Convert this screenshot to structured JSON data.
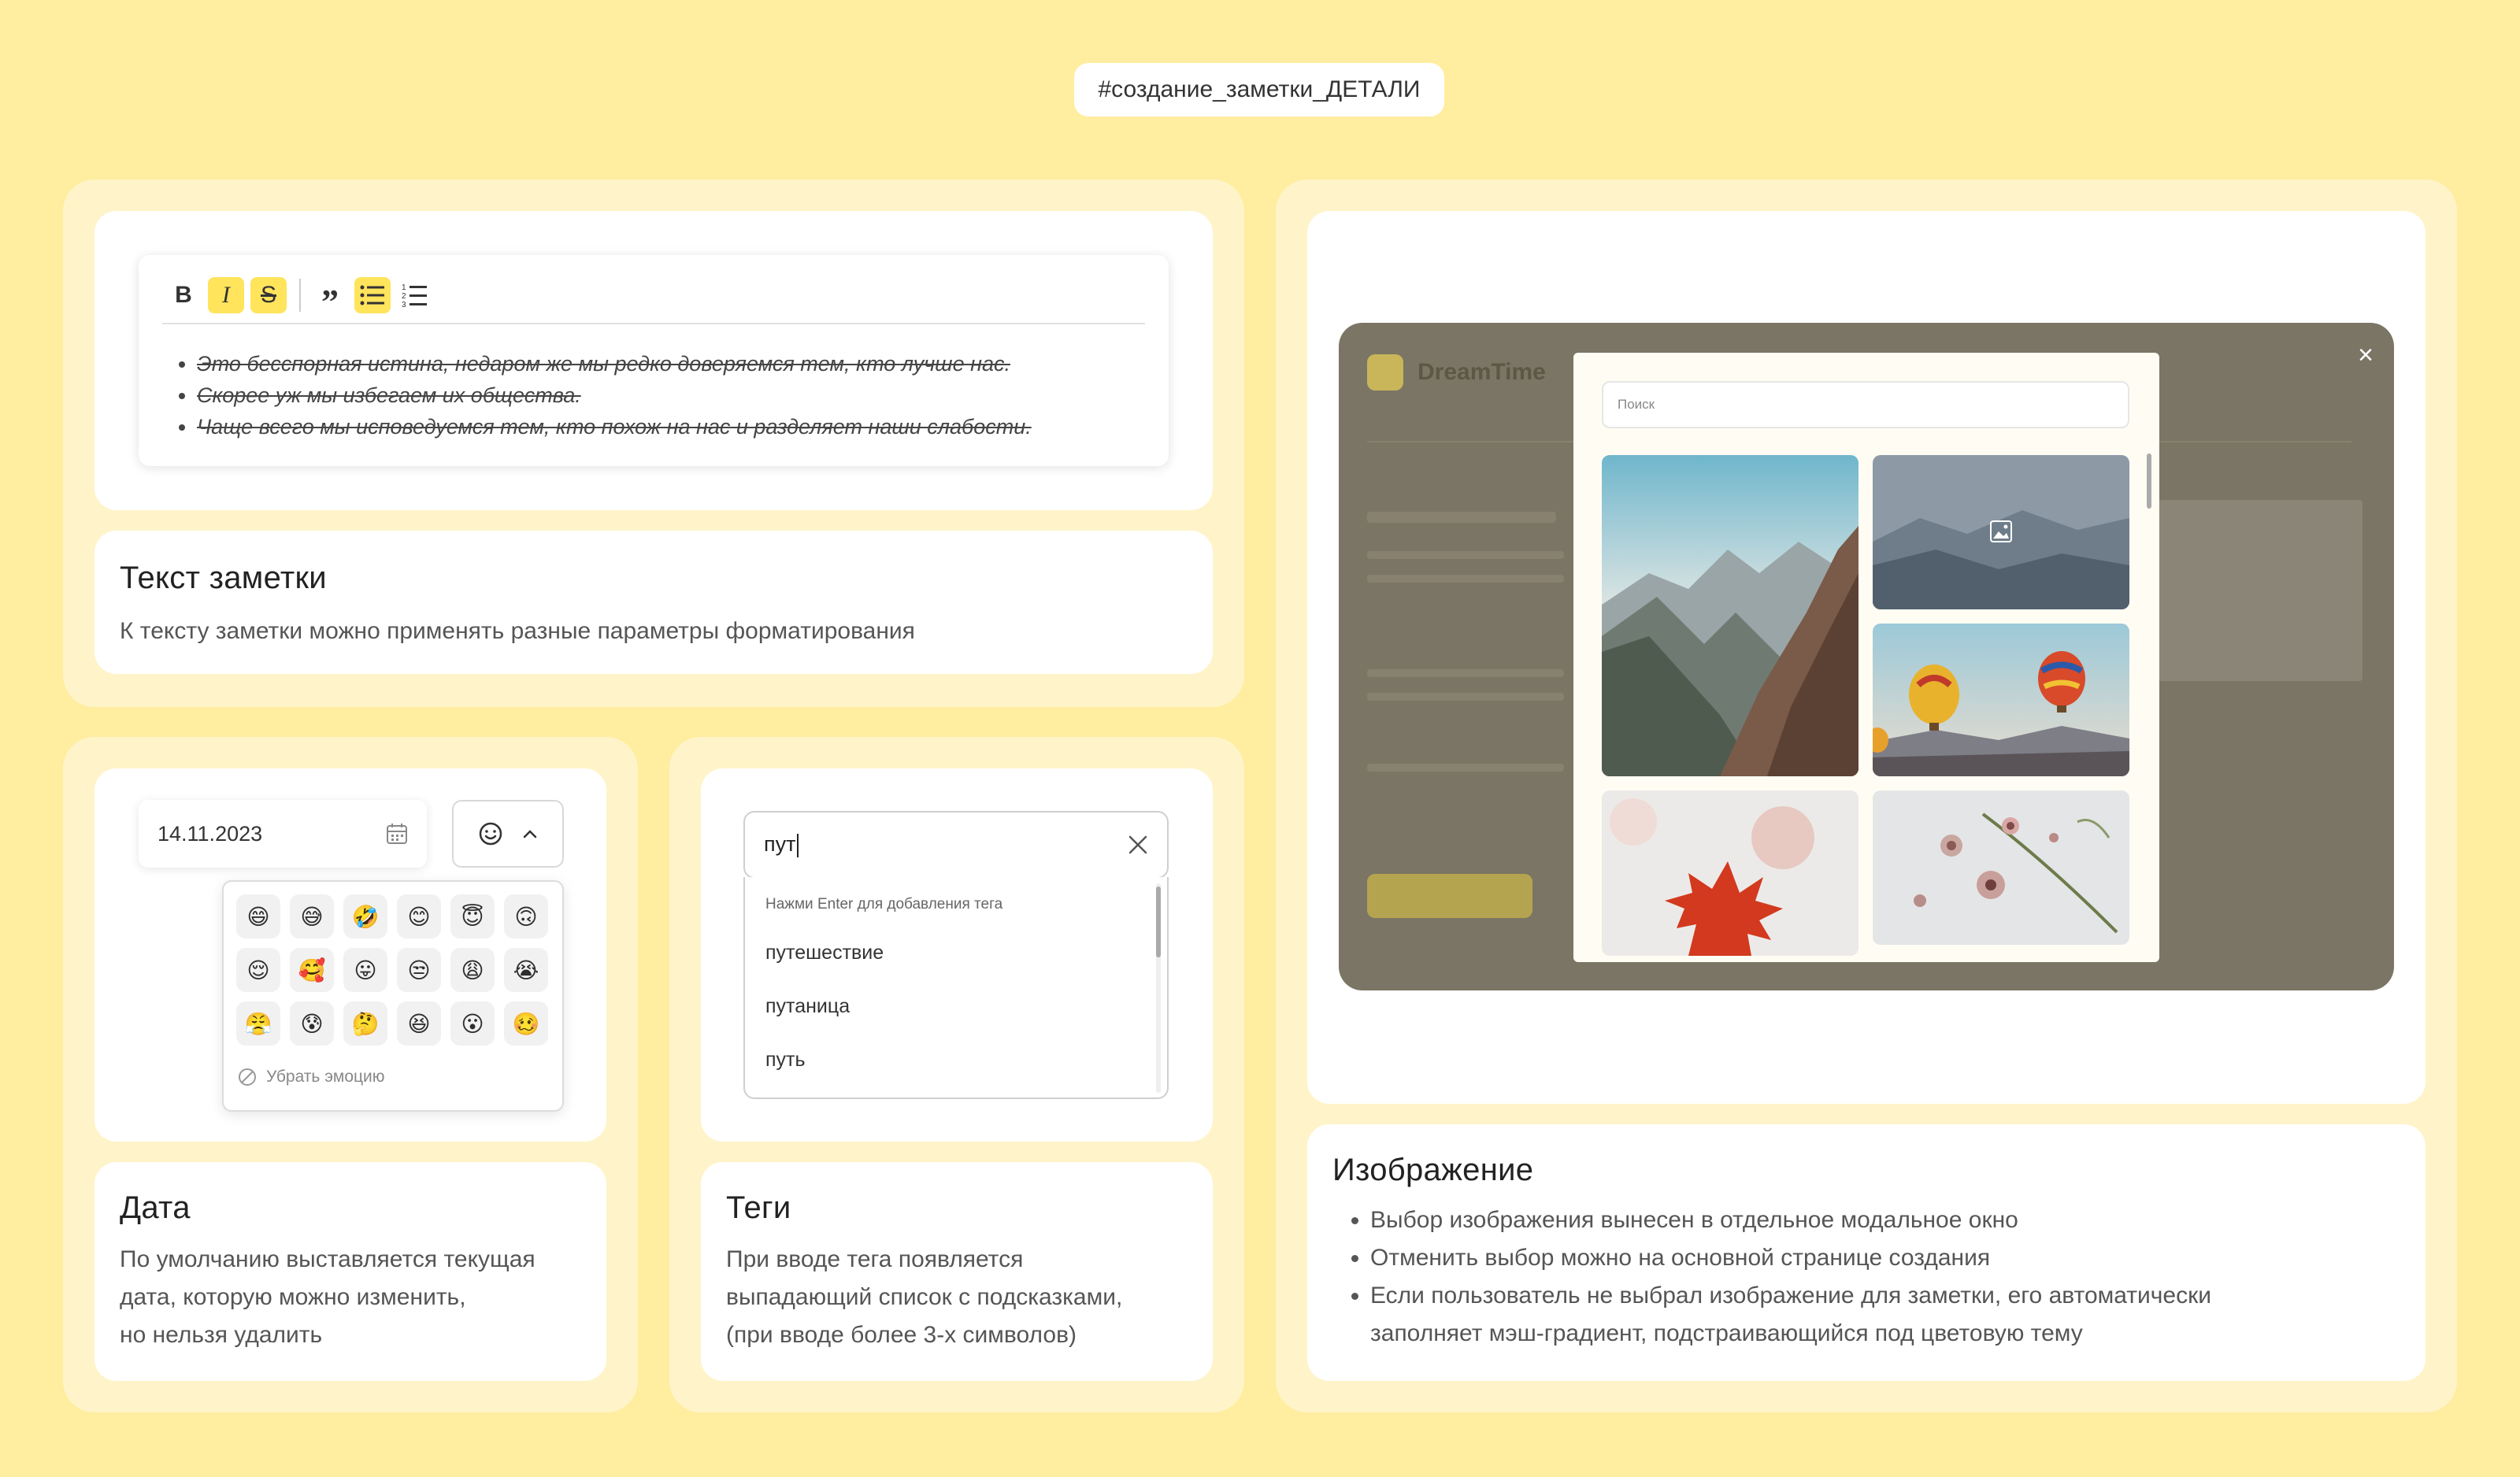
{
  "header": {
    "tag": "#создание_заметки_ДЕТАЛИ"
  },
  "text_card": {
    "title": "Текст заметки",
    "description": "К тексту заметки можно применять разные параметры форматирования",
    "toolbar": {
      "bold": "B",
      "italic": "I",
      "strike": "S",
      "quote": "”",
      "bullets": "bulleted-list",
      "numbered": "numbered-list"
    },
    "bullets": [
      "Это бесспорная истина, недаром же мы редко доверяемся тем, кто лучше нас.",
      "Скорее уж мы избегаем их общества.",
      "Чаще всего мы исповедуемся тем, кто похож на нас и разделяет наши слабости."
    ]
  },
  "date_card": {
    "title": "Дата",
    "description": [
      "По умолчанию выставляется текущая",
      "дата, которую можно изменить,",
      "но нельзя удалить"
    ],
    "date_value": "14.11.2023",
    "emojis": [
      "😄",
      "😅",
      "🤣",
      "😊",
      "😇",
      "🙃",
      "😌",
      "🥰",
      "😛",
      "😒",
      "😩",
      "😭",
      "😤",
      "😰",
      "🤔",
      "😆",
      "😮",
      "🥴"
    ],
    "remove_label": "Убрать эмоцию"
  },
  "tags_card": {
    "title": "Теги",
    "description": [
      "При вводе тега появляется",
      "выпадающий список с подсказками,",
      "(при вводе более 3-х символов)"
    ],
    "input_value": "пут",
    "hint": "Нажми Enter для добавления тега",
    "options": [
      "путешествие",
      "путаница",
      "путь"
    ]
  },
  "image_card": {
    "title": "Изображение",
    "bullets": [
      "Выбор изображения вынесен в отдельное модальное окно",
      "Отменить выбор можно на основной странице создания",
      "Если пользователь не выбрал изображение для заметки, его автоматически заполняет мэш-градиент, подстраивающийся под цветовую тему"
    ],
    "background_app_name": "DreamTime",
    "search_placeholder": "Поиск",
    "close_icon": "×"
  },
  "colors": {
    "page_bg": "#FFEDA0",
    "accent": "#FFE45C",
    "panel": "#FFF4C9"
  }
}
